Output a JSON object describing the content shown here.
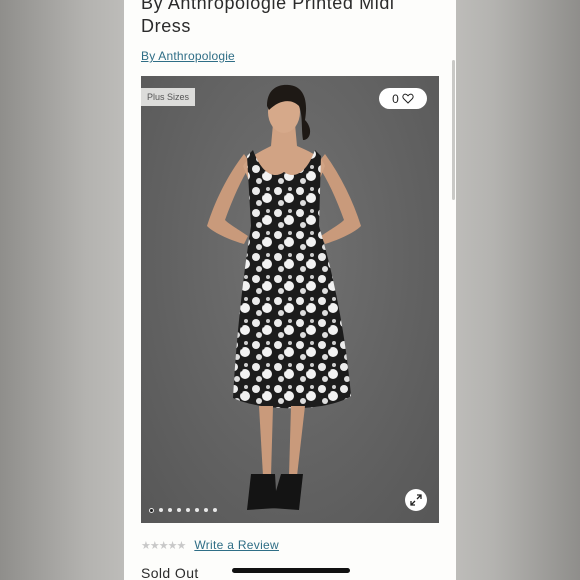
{
  "product": {
    "title": "By Anthropologie Printed Midi Dress",
    "brand_link": "By Anthropologie",
    "badge": "Plus Sizes",
    "favorite_count": "0",
    "rating_stars": "★★★★★",
    "rating_value": 0,
    "write_review": "Write a Review",
    "status": "Sold Out"
  },
  "gallery": {
    "total_images": 8,
    "active_index": 0
  },
  "icons": {
    "favorite": "heart-outline-icon",
    "expand": "expand-arrows-icon"
  },
  "colors": {
    "link": "#2f6e86",
    "text": "#2b2b2b",
    "photo_background": "#666666"
  }
}
